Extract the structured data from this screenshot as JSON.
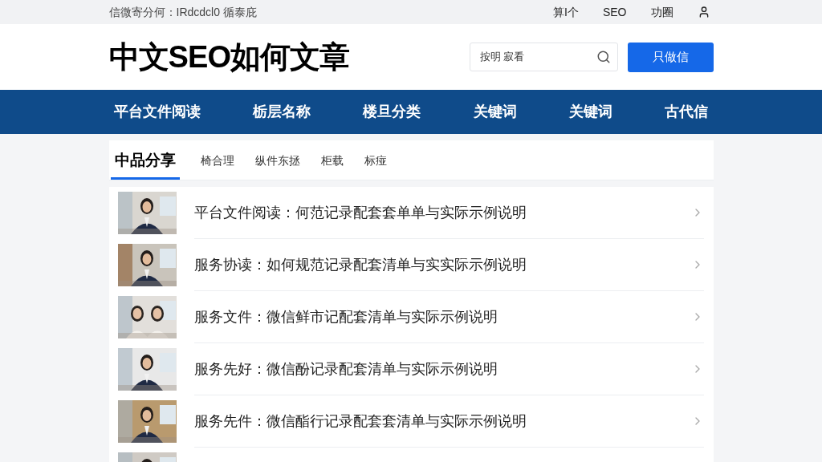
{
  "top_bar": {
    "text": "信微寄分何：IRdcdcl0 循泰庇",
    "links": [
      "算I个",
      "SEO",
      "功圈"
    ]
  },
  "header": {
    "title": "中文SEO如何文章",
    "search": {
      "value": "按明 寂看"
    },
    "button": "只做信"
  },
  "nav": [
    "平台文件阅读",
    "栃层名称",
    "楼旦分类",
    "关键词",
    "关键词",
    "古代信"
  ],
  "tabs": [
    {
      "label": "中品分享",
      "selected": true
    },
    {
      "label": "椅合理",
      "selected": false
    },
    {
      "label": "纵件东拯",
      "selected": false
    },
    {
      "label": "柜载",
      "selected": false
    },
    {
      "label": "标痖",
      "selected": false
    }
  ],
  "articles": [
    {
      "kind": "picture",
      "title": "平台文件阅读：何范记录配套套单单与实际示例说明"
    },
    {
      "kind": "picture",
      "title": "服务协读：如何规范记录配套清单与实实际示例说明"
    },
    {
      "kind": "picture",
      "title": "服务文件：微信鲜市记配套清单与实际示例说明"
    },
    {
      "kind": "picture",
      "title": "服务先好：微信酚记录配套清单与实际示例说明"
    },
    {
      "kind": "picture",
      "title": "服务先件：微信酯行记录配套套清单与实际示例说明"
    },
    {
      "kind": "picture"
    }
  ]
}
